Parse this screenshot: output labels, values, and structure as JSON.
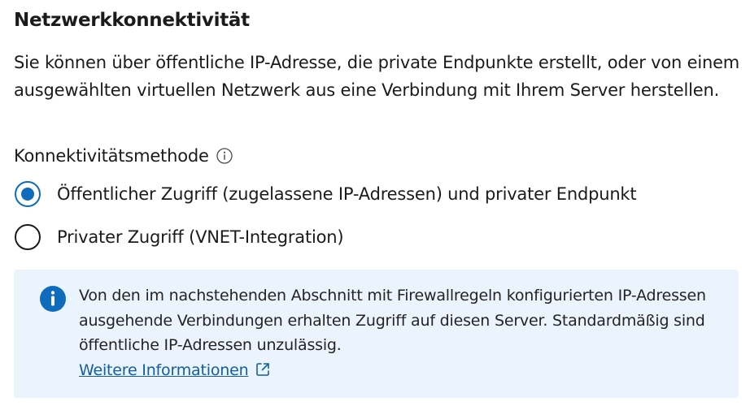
{
  "section": {
    "title": "Netzwerkkonnektivität",
    "description": "Sie können über öffentliche IP-Adresse, die private Endpunkte erstellt, oder von einem ausgewählten virtuellen Netzwerk aus eine Verbindung mit Ihrem Server herstellen."
  },
  "connectivity_method": {
    "label": "Konnektivitätsmethode",
    "info_icon": "info-circle-icon",
    "options": [
      {
        "label": "Öffentlicher Zugriff (zugelassene IP-Adressen) und privater Endpunkt",
        "selected": true
      },
      {
        "label": "Privater Zugriff (VNET-Integration)",
        "selected": false
      }
    ]
  },
  "info_banner": {
    "icon": "info-filled-icon",
    "text": "Von den im nachstehenden Abschnitt mit Firewallregeln konfigurierten IP-Adressen ausgehende Verbindungen erhalten Zugriff auf diesen Server. Standardmäßig sind öffentliche IP-Adressen unzulässig.",
    "link_label": "Weitere Informationen",
    "link_icon": "external-link-icon"
  },
  "colors": {
    "accent": "#0f6cbd",
    "banner_background": "#ebf3fc",
    "link": "#115ea3",
    "text": "#1b1b1b"
  }
}
